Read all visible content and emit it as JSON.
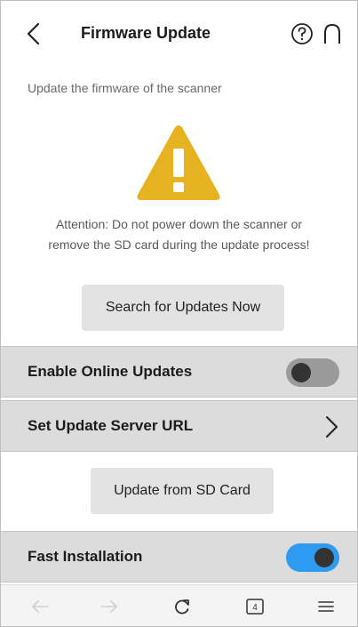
{
  "header": {
    "title": "Firmware Update",
    "back_icon": "chevron-left-icon",
    "help_icon": "help-circle-icon",
    "home_icon": "home-icon"
  },
  "content": {
    "subtitle": "Update the firmware of the scanner",
    "warning_icon": "warning-icon",
    "warning_color": "#e6b21f",
    "attention_line1": "Attention: Do not power down the scanner or",
    "attention_line2": "remove the SD card during the update process!",
    "search_button_label": "Search for Updates Now",
    "sd_button_label": "Update from SD Card"
  },
  "settings": {
    "online_updates": {
      "label": "Enable Online Updates",
      "enabled": false
    },
    "server_url": {
      "label": "Set Update Server URL"
    },
    "fast_installation": {
      "label": "Fast Installation",
      "enabled": true
    }
  },
  "browser_bar": {
    "tab_count": "4",
    "icons": [
      "back-arrow-icon",
      "forward-arrow-icon",
      "reload-icon",
      "tabs-icon",
      "menu-icon"
    ]
  },
  "colors": {
    "toggle_on": "#2f9bf0",
    "toggle_off": "#9a9a9a",
    "row_background": "#dcdcdc"
  }
}
